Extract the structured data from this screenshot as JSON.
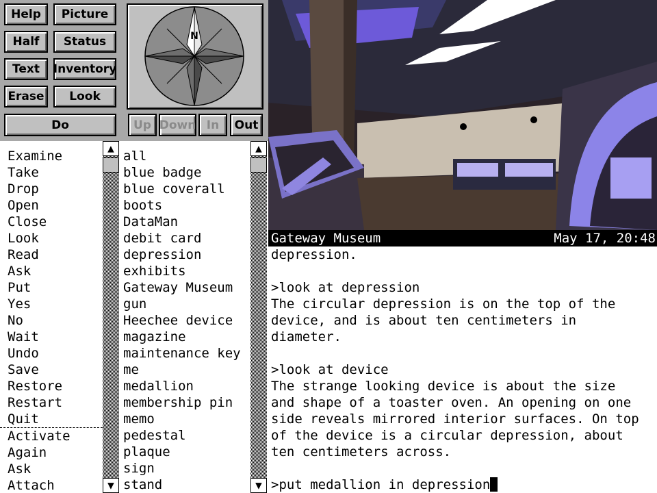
{
  "buttons": {
    "help": "Help",
    "picture": "Picture",
    "half": "Half",
    "status": "Status",
    "text": "Text",
    "inventory": "Inventory",
    "erase": "Erase",
    "look": "Look",
    "do": "Do",
    "up": "Up",
    "down": "Down",
    "in": "In",
    "out": "Out"
  },
  "compass": {
    "north": "N"
  },
  "verbs": [
    "Examine",
    "Take",
    "Drop",
    "Open",
    "Close",
    "Look",
    "Read",
    "Ask",
    "Put",
    "Yes",
    "No",
    "Wait",
    "Undo",
    "Save",
    "Restore",
    "Restart",
    "Quit"
  ],
  "verbs_extra": [
    "Activate",
    "Again",
    "Ask",
    "Attach"
  ],
  "nouns": [
    "all",
    "blue badge",
    "blue coverall",
    "boots",
    "DataMan",
    "debit card",
    "depression",
    "exhibits",
    "Gateway Museum",
    "gun",
    "Heechee device",
    "magazine",
    "maintenance key",
    "me",
    "medallion",
    "membership pin",
    "memo",
    "pedestal",
    "plaque",
    "sign",
    "stand"
  ],
  "status": {
    "location": "Gateway Museum",
    "datetime": "May 17, 20:48"
  },
  "transcript": [
    "depression.",
    "",
    ">look at depression",
    "The circular depression is on the top of the",
    "device, and is about ten centimeters in",
    "diameter.",
    "",
    ">look at device",
    "The strange looking device is about the size",
    "and shape of a toaster oven. An opening on one",
    "side reveals mirrored interior surfaces. On top",
    "of the device is a circular depression, about",
    "ten centimeters across.",
    ""
  ],
  "input_line": ">put medallion in depression"
}
